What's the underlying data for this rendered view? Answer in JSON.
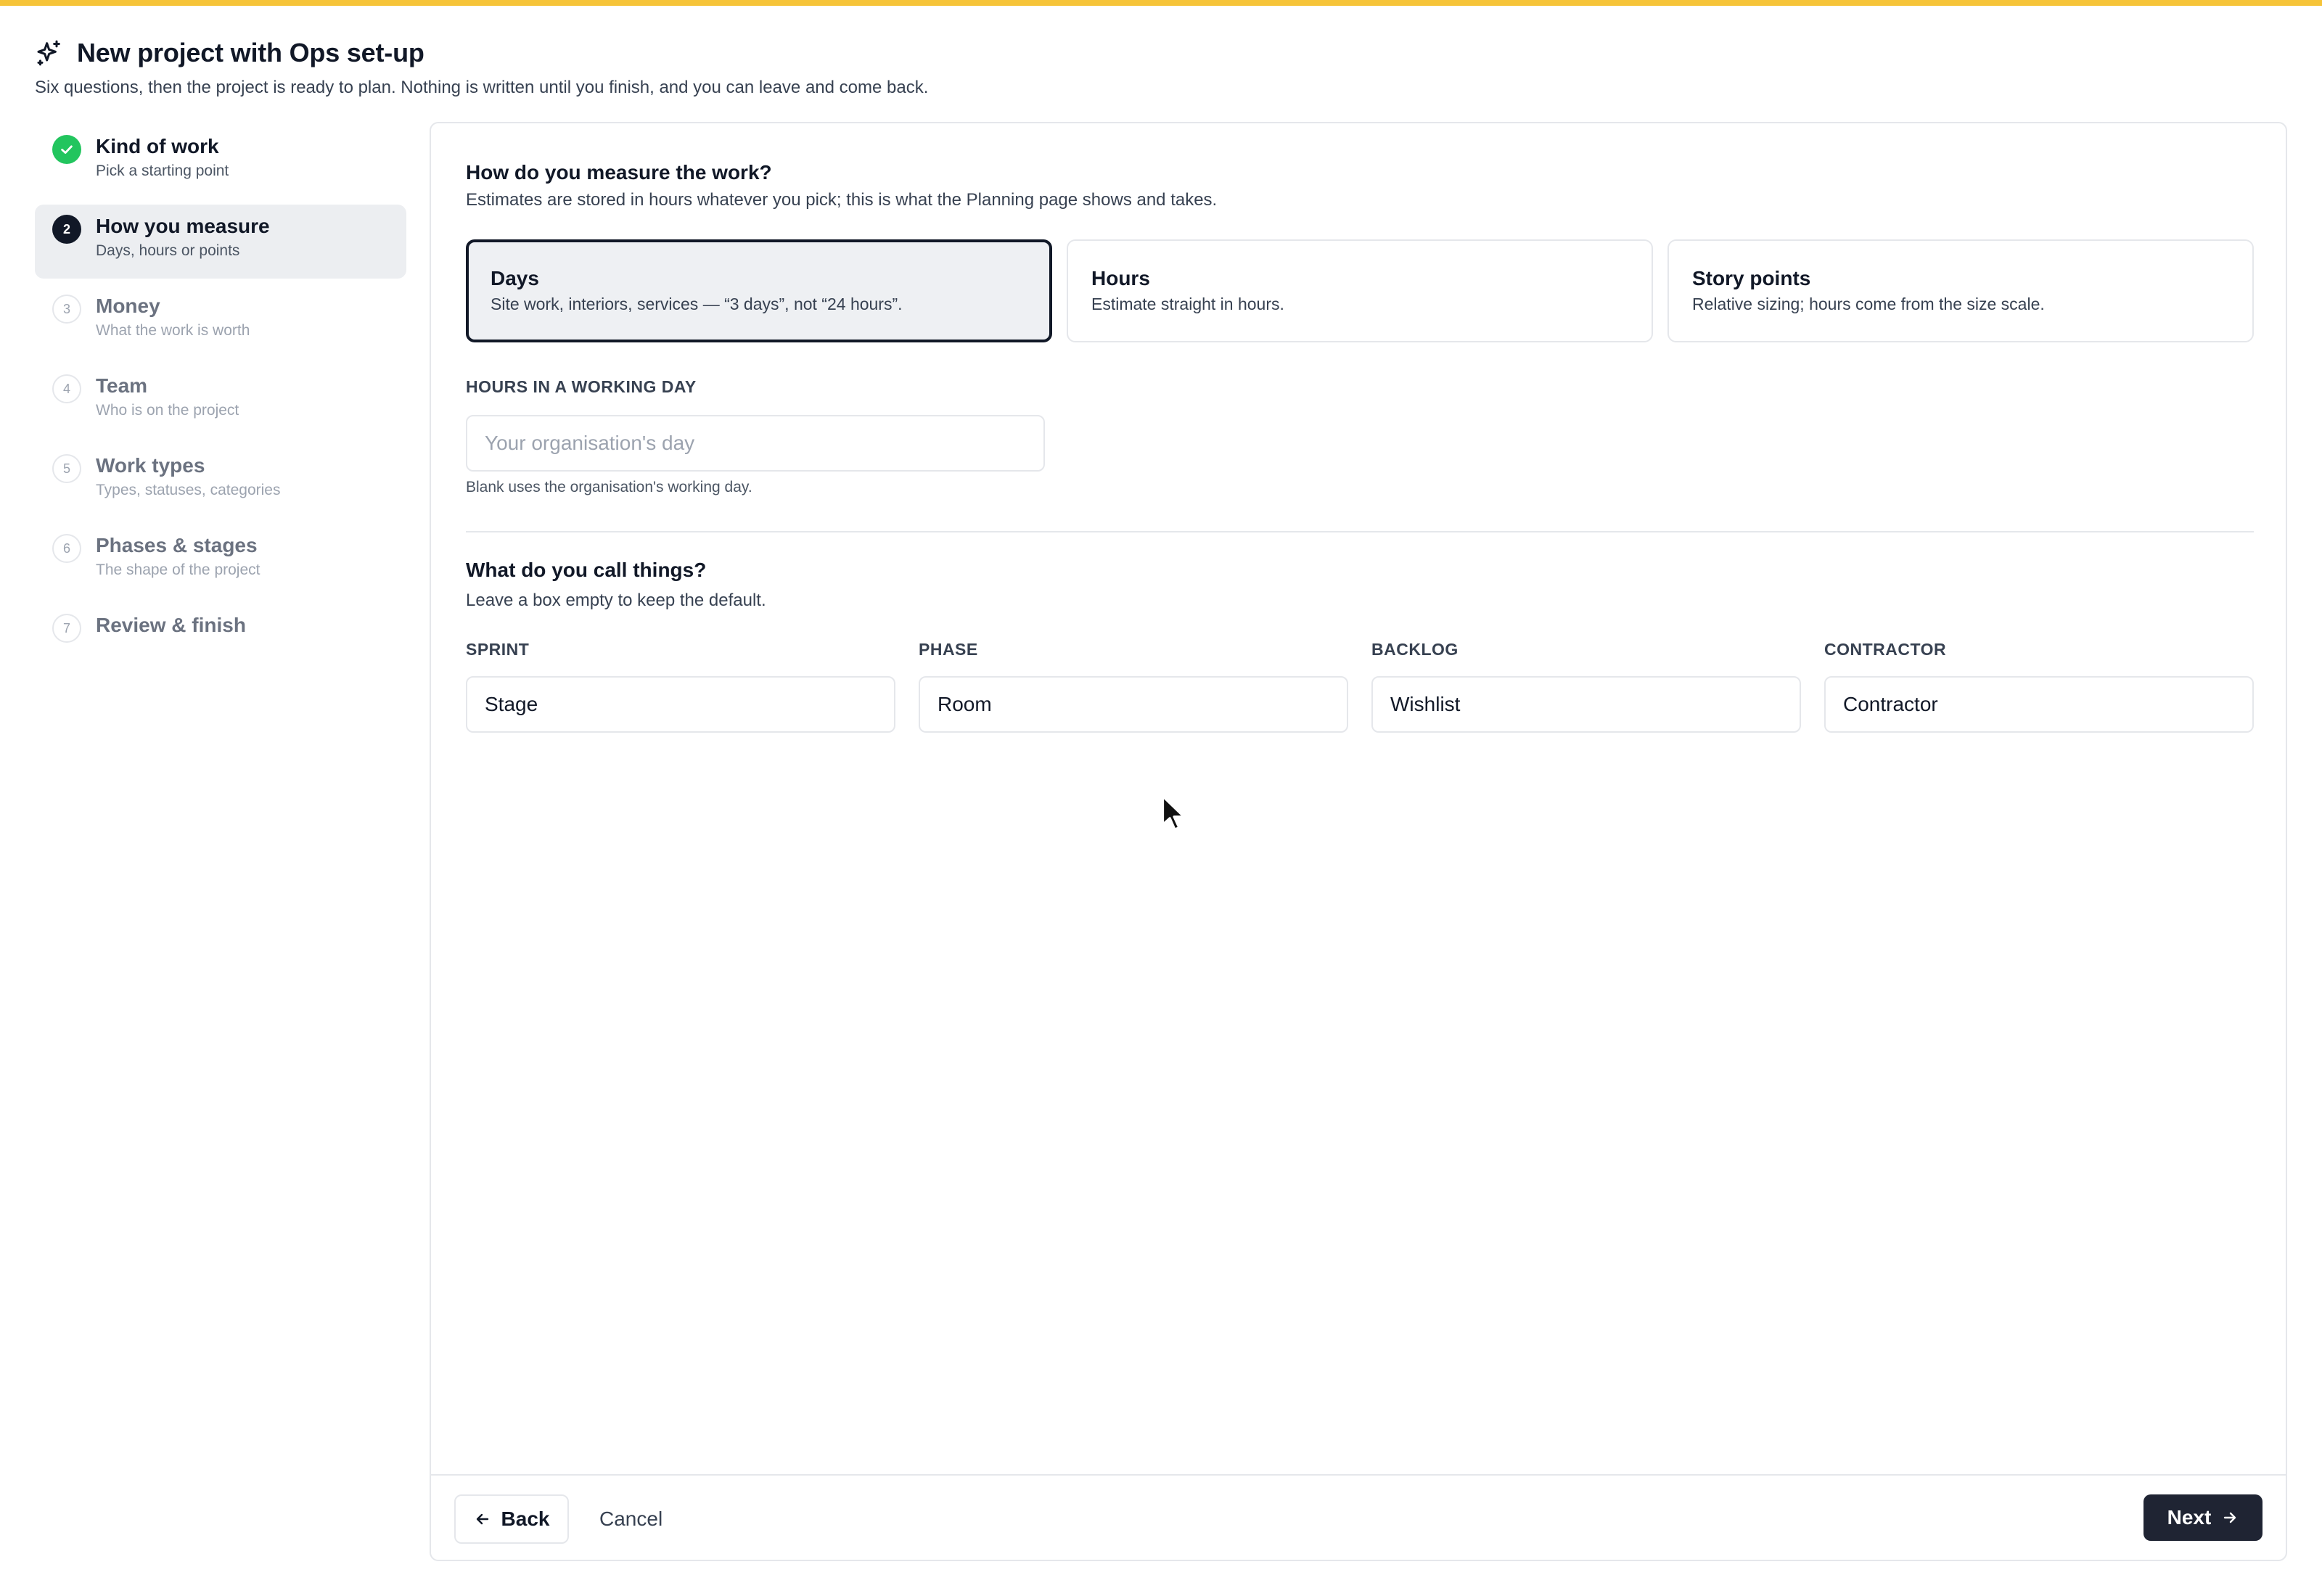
{
  "colors": {
    "accent_bar": "#f6c439",
    "done": "#22c55e",
    "primary": "#1f2433"
  },
  "header": {
    "icon": "sparkles-icon",
    "title": "New project with Ops set-up",
    "subtitle": "Six questions, then the project is ready to plan. Nothing is written until you finish, and you can leave and come back."
  },
  "sidebar": {
    "steps": [
      {
        "badge": "",
        "state": "done",
        "title": "Kind of work",
        "subtitle": "Pick a starting point"
      },
      {
        "badge": "2",
        "state": "current",
        "title": "How you measure",
        "subtitle": "Days, hours or points"
      },
      {
        "badge": "3",
        "state": "todo",
        "title": "Money",
        "subtitle": "What the work is worth"
      },
      {
        "badge": "4",
        "state": "todo",
        "title": "Team",
        "subtitle": "Who is on the project"
      },
      {
        "badge": "5",
        "state": "todo",
        "title": "Work types",
        "subtitle": "Types, statuses, categories"
      },
      {
        "badge": "6",
        "state": "todo",
        "title": "Phases & stages",
        "subtitle": "The shape of the project"
      },
      {
        "badge": "7",
        "state": "todo",
        "title": "Review & finish"
      }
    ]
  },
  "main": {
    "measure": {
      "title": "How do you measure the work?",
      "subtitle": "Estimates are stored in hours whatever you pick; this is what the Planning page shows and takes.",
      "options": [
        {
          "title": "Days",
          "subtitle": "Site work, interiors, services — “3 days”, not “24 hours”.",
          "selected": true
        },
        {
          "title": "Hours",
          "subtitle": "Estimate straight in hours.",
          "selected": false
        },
        {
          "title": "Story points",
          "subtitle": "Relative sizing; hours come from the size scale.",
          "selected": false
        }
      ]
    },
    "working_day": {
      "label": "Hours in a working day",
      "value": "",
      "placeholder": "Your organisation's day",
      "help": "Blank uses the organisation's working day."
    },
    "naming": {
      "title": "What do you call things?",
      "subtitle": "Leave a box empty to keep the default.",
      "fields": [
        {
          "label": "Sprint",
          "value": "Stage"
        },
        {
          "label": "Phase",
          "value": "Room"
        },
        {
          "label": "Backlog",
          "value": "Wishlist"
        },
        {
          "label": "Contractor",
          "value": "Contractor"
        }
      ]
    }
  },
  "footer": {
    "back_label": "Back",
    "cancel_label": "Cancel",
    "next_label": "Next"
  }
}
